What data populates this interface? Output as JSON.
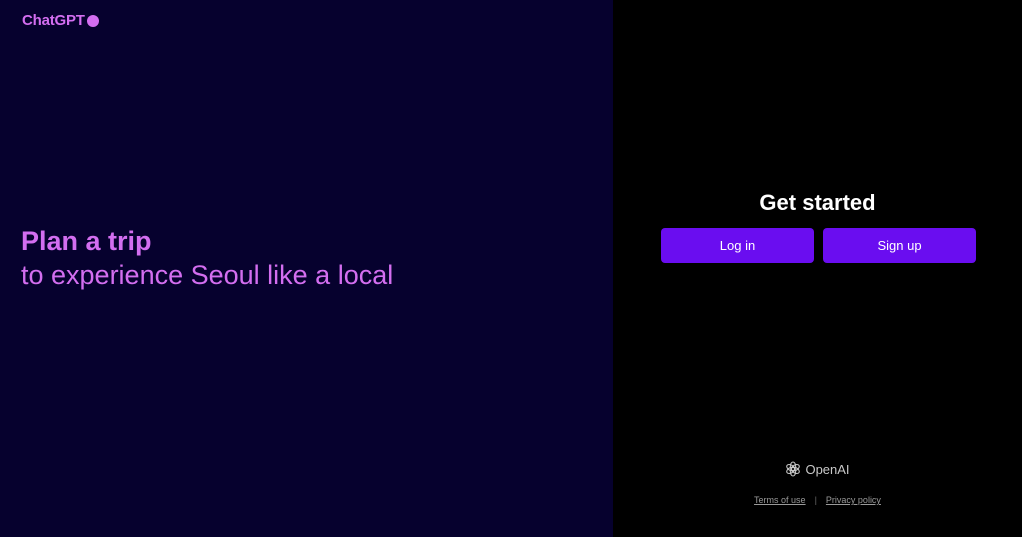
{
  "brand": {
    "logo_text": "ChatGPT",
    "accent_color": "#d36ef0"
  },
  "hero": {
    "headline_bold": "Plan a trip",
    "headline_regular": "to experience Seoul like a local"
  },
  "auth": {
    "title": "Get started",
    "login_label": "Log in",
    "signup_label": "Sign up",
    "button_color": "#6a0df0"
  },
  "footer": {
    "company": "OpenAI",
    "company_icon": "openai-logo-icon",
    "terms_label": "Terms of use",
    "separator": "|",
    "privacy_label": "Privacy policy"
  }
}
